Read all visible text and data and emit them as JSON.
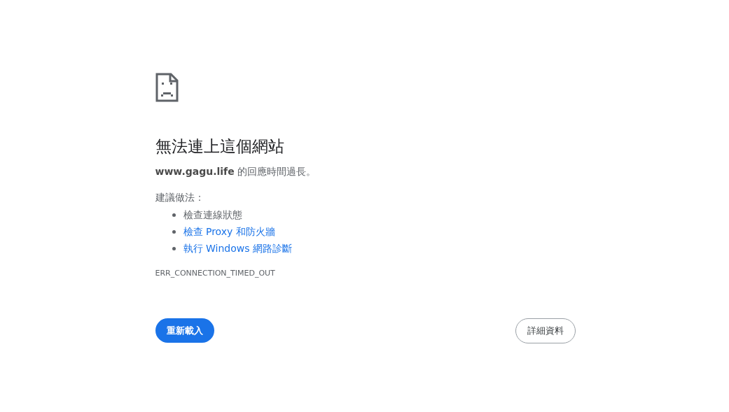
{
  "error": {
    "title": "無法連上這個網站",
    "host": "www.gagu.life",
    "message": " 的回應時間過長。",
    "suggestions_heading": "建議做法：",
    "suggestions": [
      {
        "kind": "text",
        "label": "檢查連線狀態"
      },
      {
        "kind": "link",
        "label": "檢查 Proxy 和防火牆"
      },
      {
        "kind": "link",
        "label": "執行 Windows 網路診斷"
      }
    ],
    "code": "ERR_CONNECTION_TIMED_OUT"
  },
  "buttons": {
    "reload": "重新載入",
    "details": "詳細資料"
  }
}
